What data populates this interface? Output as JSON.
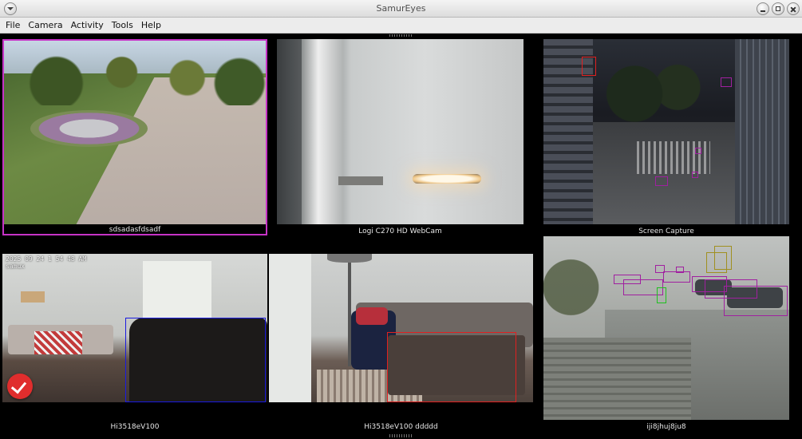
{
  "window": {
    "title": "SamurEyes"
  },
  "menu": [
    "File",
    "Camera",
    "Activity",
    "Tools",
    "Help"
  ],
  "cameras": [
    {
      "name": "sdsadasfdsadf"
    },
    {
      "name": "Logi C270 HD WebCam"
    },
    {
      "name": "Screen Capture"
    },
    {
      "name": "Hi3518eV100",
      "timestamp": "2025 09 24 1 54 48 AM",
      "osd": "samux"
    },
    {
      "name": "Hi3518eV100 ddddd"
    },
    {
      "name": "iji8jhuj8ju8"
    }
  ],
  "colors": {
    "selected": "#c633c6",
    "detection_red": "#e02020",
    "detection_blue": "#1a1ae0",
    "detection_purple": "#a020a0",
    "detection_olive": "#a09020",
    "detection_green": "#20c020",
    "check": "#e02d2d"
  },
  "icons": {
    "window_menu": "chevron-down-icon",
    "minimize": "minimize-icon",
    "maximize": "maximize-icon",
    "close": "close-icon",
    "status": "check-icon"
  }
}
